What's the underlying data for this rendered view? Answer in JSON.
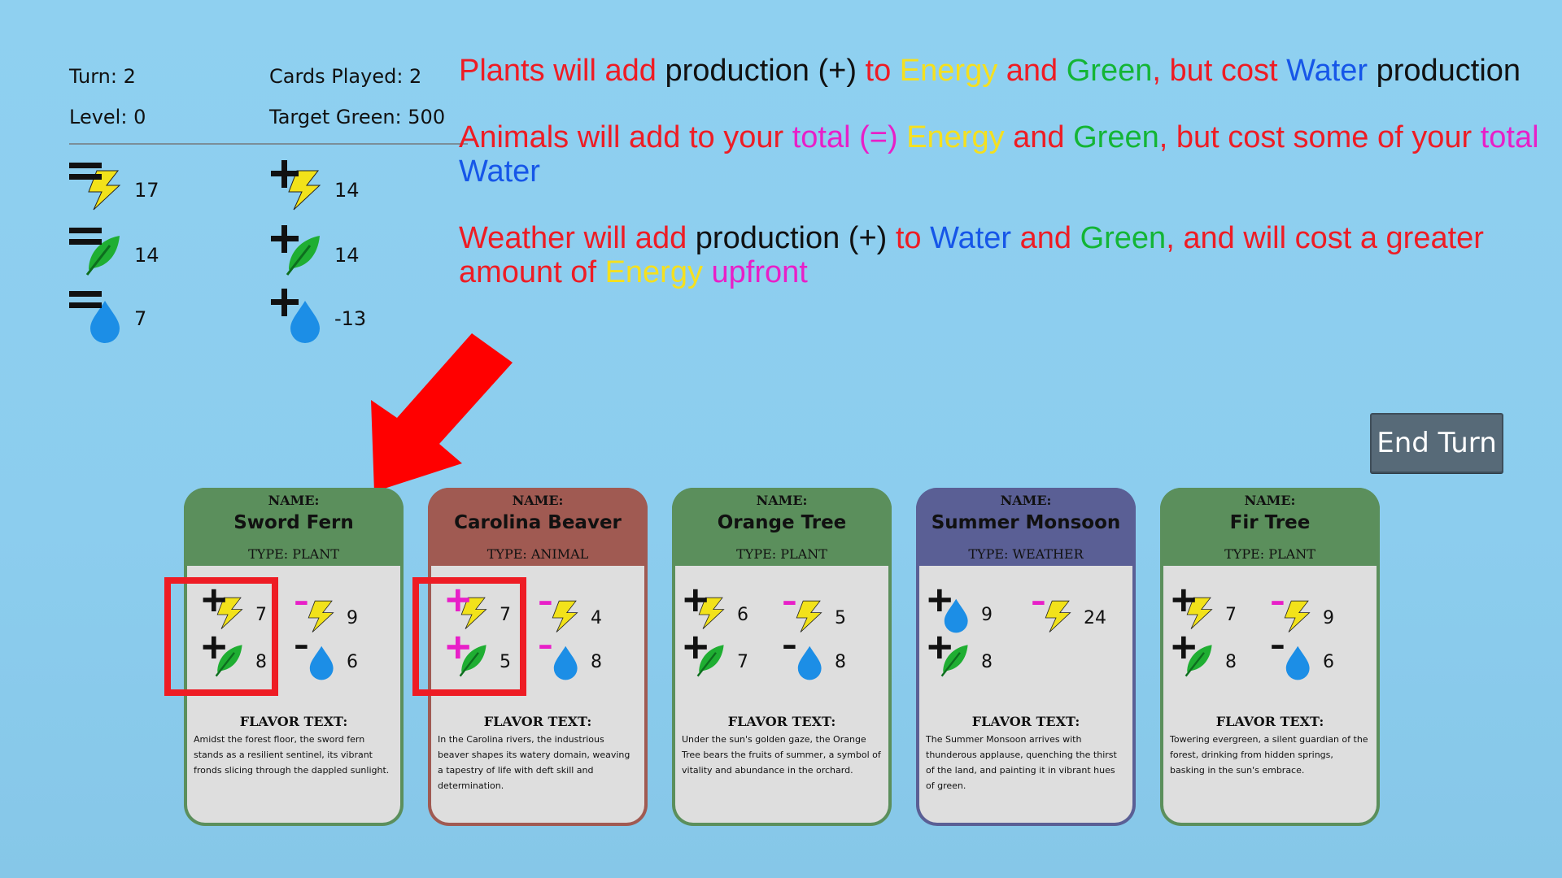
{
  "status": {
    "turn": "Turn: 2",
    "cards_played": "Cards Played: 2",
    "level": "Level: 0",
    "target_green": "Target Green: 500"
  },
  "resources": [
    {
      "name": "energy-total",
      "icon": "equals-energy-icon",
      "value": "17"
    },
    {
      "name": "energy-production",
      "icon": "plus-energy-icon",
      "value": "14"
    },
    {
      "name": "green-total",
      "icon": "equals-green-icon",
      "value": "14"
    },
    {
      "name": "green-production",
      "icon": "plus-green-icon",
      "value": "14"
    },
    {
      "name": "water-total",
      "icon": "equals-water-icon",
      "value": "7"
    },
    {
      "name": "water-production",
      "icon": "plus-water-icon",
      "value": "-13"
    }
  ],
  "rules": {
    "plants": [
      "Plants will add ",
      "production (+)",
      " to ",
      "Energy",
      " and ",
      "Green",
      ", but cost ",
      "Water",
      " production"
    ],
    "animals": [
      "Animals will add to your ",
      "total (=)",
      " ",
      "Energy",
      " and ",
      "Green",
      ", but cost some of your ",
      "total",
      " ",
      "Water"
    ],
    "weather": [
      "Weather will add ",
      "production (+)",
      " to ",
      "Water",
      " and ",
      "Green",
      ", and will cost a greater amount of ",
      "Energy",
      " ",
      "upfront"
    ]
  },
  "end_turn_label": "End Turn",
  "cards": [
    {
      "name_label": "NAME:",
      "name": "Sword Fern",
      "type": "TYPE: PLANT",
      "header_color": "#5b8f5c",
      "border": "#5b8f5c",
      "stats": [
        "7",
        "8",
        "9",
        "6"
      ],
      "flavor_label": "FLAVOR TEXT:",
      "flavor": "Amidst the forest floor, the sword fern stands as a resilient sentinel, its vibrant fronds slicing through the dappled sunlight."
    },
    {
      "name_label": "NAME:",
      "name": "Carolina Beaver",
      "type": "TYPE: ANIMAL",
      "header_color": "#a05a52",
      "border": "#a05a52",
      "stats": [
        "7",
        "5",
        "4",
        "8"
      ],
      "flavor_label": "FLAVOR TEXT:",
      "flavor": "In the Carolina rivers, the industrious beaver shapes its watery domain, weaving a tapestry of life with deft skill and determination."
    },
    {
      "name_label": "NAME:",
      "name": "Orange Tree",
      "type": "TYPE: PLANT",
      "header_color": "#5b8f5c",
      "border": "#5b8f5c",
      "stats": [
        "6",
        "7",
        "5",
        "8"
      ],
      "flavor_label": "FLAVOR TEXT:",
      "flavor": "Under the sun's golden gaze, the Orange Tree bears the fruits of summer, a symbol of vitality and abundance in the orchard."
    },
    {
      "name_label": "NAME:",
      "name": "Summer Monsoon",
      "type": "TYPE: WEATHER",
      "header_color": "#5a5f95",
      "border": "#5a5f95",
      "stats": [
        "9",
        "8",
        "24",
        ""
      ],
      "flavor_label": "FLAVOR TEXT:",
      "flavor": "The Summer Monsoon arrives with thunderous applause, quenching the thirst of the land, and painting it in vibrant hues of green."
    },
    {
      "name_label": "NAME:",
      "name": "Fir Tree",
      "type": "TYPE: PLANT",
      "header_color": "#5b8f5c",
      "border": "#5b8f5c",
      "stats": [
        "7",
        "8",
        "9",
        "6"
      ],
      "flavor_label": "FLAVOR TEXT:",
      "flavor": "Towering evergreen, a silent guardian of the forest, drinking from hidden springs, basking in the sun's embrace."
    }
  ],
  "colors": {
    "red": "#ee1c24",
    "yellow": "#f5e01f",
    "green": "#13b535",
    "blue": "#1656e8",
    "magenta": "#e81fc8"
  }
}
